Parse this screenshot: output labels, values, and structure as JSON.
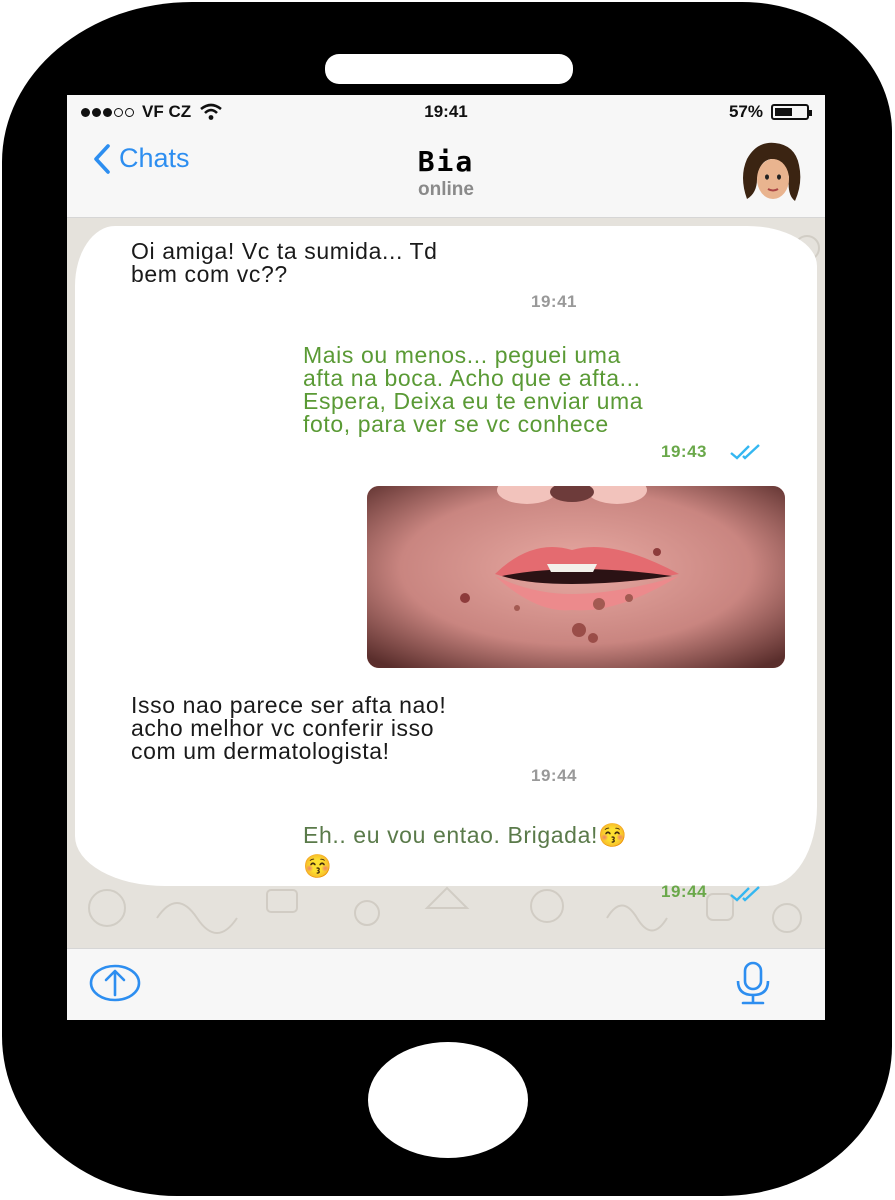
{
  "status_bar": {
    "carrier": "VF CZ",
    "time": "19:41",
    "battery": "57%",
    "battery_level": 0.57
  },
  "header": {
    "back_label": "Chats",
    "contact_name": "Bia",
    "presence": "online"
  },
  "messages": [
    {
      "direction": "in",
      "text": "Oi amiga! Vc ta sumida... Td\nbem com vc??",
      "time": "19:41"
    },
    {
      "direction": "out",
      "text": "Mais ou menos... peguei uma\nafta na boca. Acho que e afta...\nEspera, Deixa eu te enviar uma\nfoto, para ver se vc conhece",
      "time": "19:43",
      "status": "read"
    },
    {
      "direction": "out",
      "type": "photo"
    },
    {
      "direction": "in",
      "text": "Isso nao parece ser afta nao!\nacho melhor vc conferir isso\ncom um dermatologista!",
      "time": "19:44"
    },
    {
      "direction": "out",
      "text": "Eh.. eu vou entao. Brigada!😚\n😚",
      "time": "19:44",
      "status": "read"
    }
  ],
  "input_bar": {
    "share_icon": "share-upload-icon",
    "mic_icon": "microphone-icon"
  },
  "colors": {
    "accent": "#2d8ef0",
    "outgoing_text": "#5a9a35",
    "read_ticks": "#34b7f1",
    "phone_body": "#000000"
  }
}
